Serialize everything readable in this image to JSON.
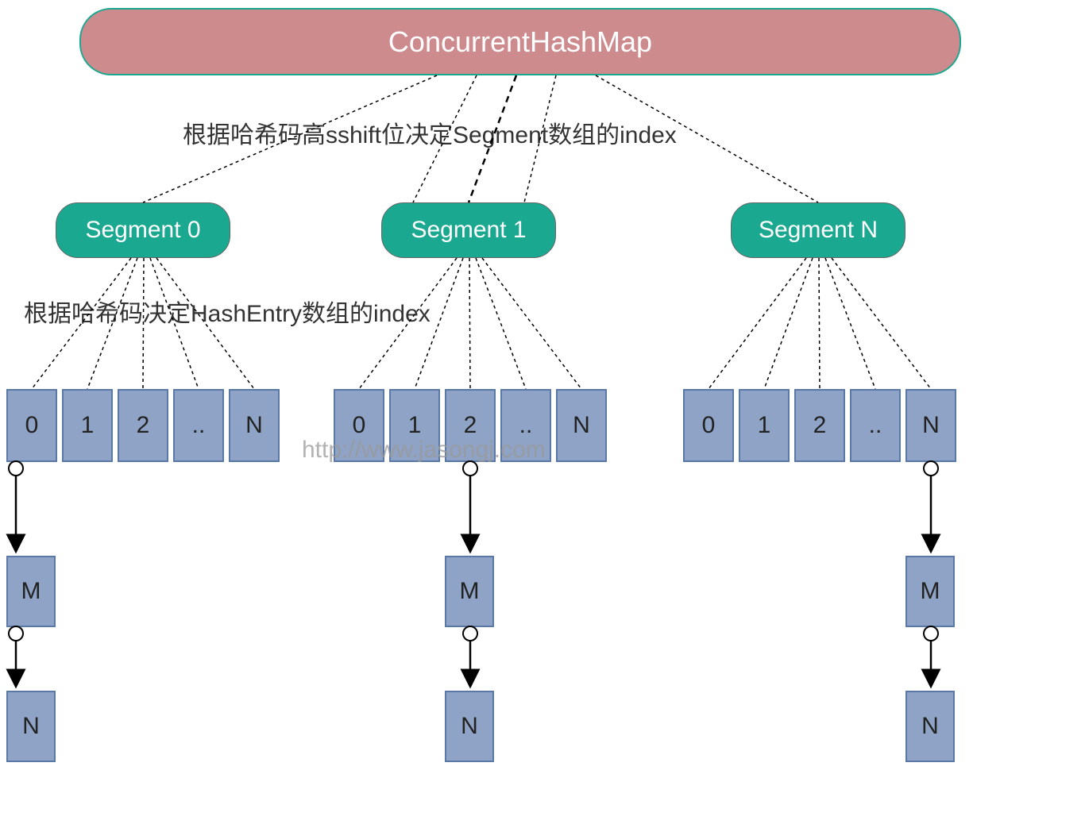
{
  "root": {
    "title": "ConcurrentHashMap"
  },
  "labels": {
    "segment_index": "根据哈希码高sshift位决定Segment数组的index",
    "entry_index": "根据哈希码决定HashEntry数组的index"
  },
  "segments": [
    {
      "name": "Segment 0"
    },
    {
      "name": "Segment 1"
    },
    {
      "name": "Segment N"
    }
  ],
  "arrays": {
    "group0": [
      "0",
      "1",
      "2",
      "..",
      "N"
    ],
    "group1": [
      "0",
      "1",
      "2",
      "..",
      "N"
    ],
    "group2": [
      "0",
      "1",
      "2",
      "..",
      "N"
    ]
  },
  "chains": {
    "g0": {
      "node1": "M",
      "node2": "N"
    },
    "g1": {
      "node1": "M",
      "node2": "N"
    },
    "g2": {
      "node1": "M",
      "node2": "N"
    }
  },
  "watermark": "http://www.jasongj.com"
}
